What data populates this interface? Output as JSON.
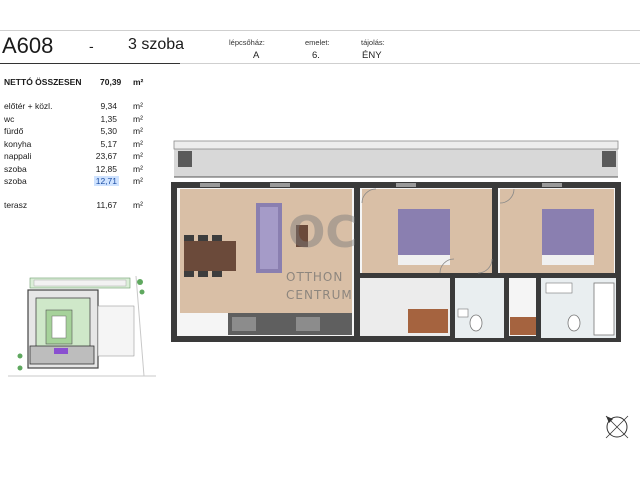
{
  "header": {
    "apartment_id": "A608",
    "dash": "-",
    "rooms": "3 szoba",
    "stairwell_label": "lépcsőház:",
    "stairwell_value": "A",
    "floor_label": "emelet:",
    "floor_value": "6.",
    "orientation_label": "tájolás:",
    "orientation_value": "ÉNY"
  },
  "summary": {
    "total_label": "NETTÓ ÖSSZESEN",
    "total_value": "70,39",
    "unit": "m²"
  },
  "rooms": [
    {
      "label": "előtér + közl.",
      "value": "9,34",
      "unit": "m²"
    },
    {
      "label": "wc",
      "value": "1,35",
      "unit": "m²"
    },
    {
      "label": "fürdő",
      "value": "5,30",
      "unit": "m²"
    },
    {
      "label": "konyha",
      "value": "5,17",
      "unit": "m²"
    },
    {
      "label": "nappali",
      "value": "23,67",
      "unit": "m²"
    },
    {
      "label": "szoba",
      "value": "12,85",
      "unit": "m²"
    },
    {
      "label": "szoba",
      "value": "12,71",
      "unit": "m²"
    }
  ],
  "terrace": {
    "label": "terasz",
    "value": "11,67",
    "unit": "m²"
  },
  "watermark": {
    "line1": "OTTHON",
    "line2": "CENTRUM"
  },
  "colors": {
    "wall": "#444444",
    "floor_wood": "#d9bfa6",
    "bed": "#8a7fb0",
    "terrace": "#cfcfcf",
    "highlight": "#cfe3ff",
    "site_highlight": "#8a4fd0"
  }
}
